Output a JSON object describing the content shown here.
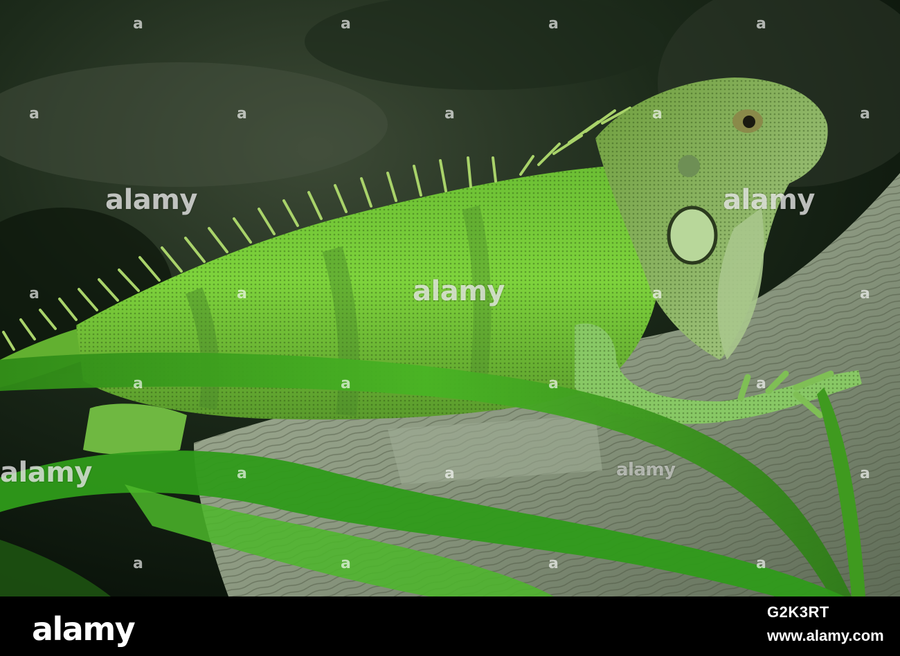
{
  "photo": {
    "subject": "iguana-on-log",
    "colors": {
      "background_dark": "#0e1a10",
      "iguana_green": "#7fd43a",
      "log_gray": "#8c9a82",
      "leaf_green": "#3fa820"
    }
  },
  "watermark": {
    "text": "alamy",
    "mark": "a"
  },
  "footer": {
    "logo": "alamy",
    "image_id": "G2K3RT",
    "url": "www.alamy.com"
  }
}
